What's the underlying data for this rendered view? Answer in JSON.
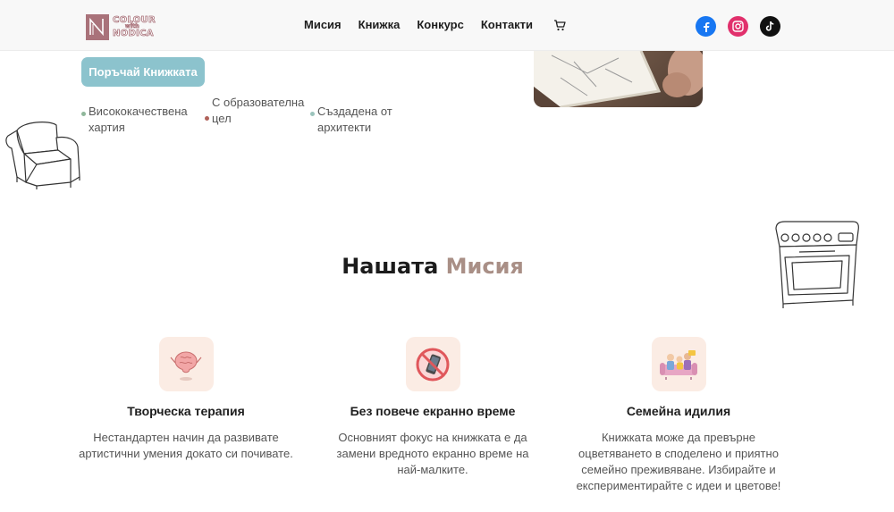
{
  "header": {
    "logo_alt": "Colour with Nodica",
    "logo_line1": "COLOUR",
    "logo_line2": "with",
    "logo_line3": "NODICA",
    "nav": [
      "Мисия",
      "Книжка",
      "Конкурс",
      "Контакти"
    ],
    "social": [
      "facebook-icon",
      "instagram-icon",
      "tiktok-icon"
    ]
  },
  "hero": {
    "order_button": "Поръчай Книжката",
    "features": [
      {
        "text": "Висококачествена хартия",
        "dot_color": "#8fb79a"
      },
      {
        "text": "С образователна цел",
        "dot_color": "#b0625a"
      },
      {
        "text": "Създадена от архитекти",
        "dot_color": "#9bc4bc"
      }
    ]
  },
  "mission": {
    "title_main": "Нашата",
    "title_accent": "Мисия",
    "cards": [
      {
        "title": "Творческа терапия",
        "text": "Нестандартен начин да развивате артистични умения докато си почивате."
      },
      {
        "title": "Без повече екранно време",
        "text": "Основният фокус на книжката е да замени вредното екранно време на най-малките."
      },
      {
        "title": "Семейна идилия",
        "text": "Книжката може да превърне оцветяването в споделено и приятно семейно преживяване. Избирайте и експериментирайте с идеи и цветове!"
      }
    ]
  },
  "colors": {
    "accent_button": "#8cc3cd",
    "title_accent": "#a98f86",
    "icon_bg": "#fbece4",
    "logo": "#a9727a"
  }
}
